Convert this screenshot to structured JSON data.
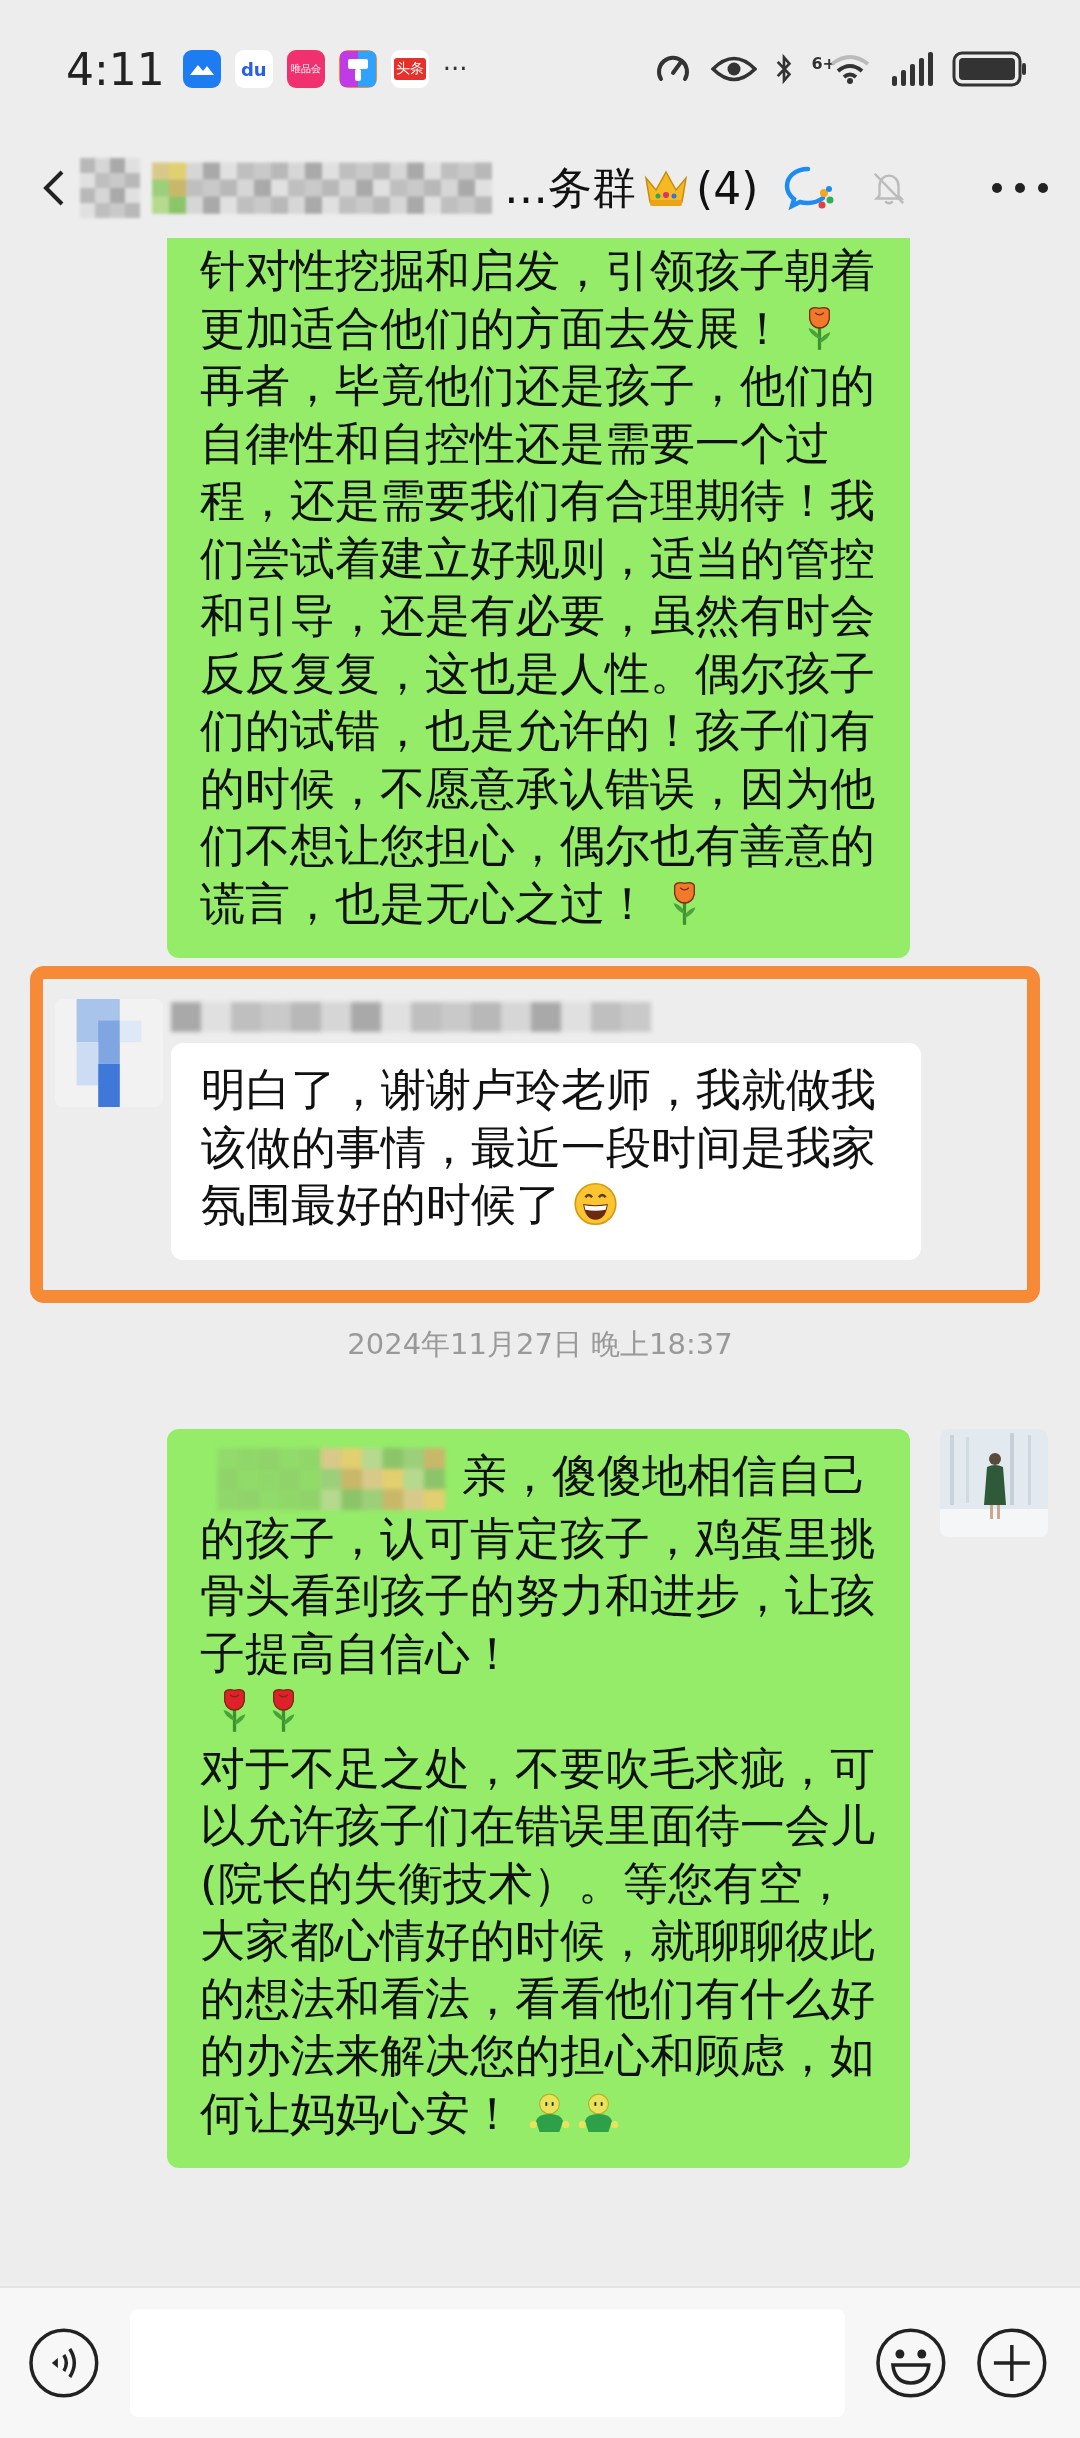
{
  "status_bar": {
    "time": "4:11",
    "notification_icons": [
      {
        "kind": "lark"
      },
      {
        "kind": "baidu",
        "text": "du"
      },
      {
        "kind": "vip",
        "text": "唯品会"
      },
      {
        "kind": "brush"
      },
      {
        "kind": "news",
        "text": "头条"
      }
    ],
    "more": "···",
    "wifi_label": "6+"
  },
  "header": {
    "title": "…务群",
    "member_count": "(4)"
  },
  "messages": [
    {
      "kind": "sent",
      "parts": [
        {
          "kind": "text",
          "text": "针对性挖掘和启发，引领孩子朝着"
        },
        {
          "kind": "text",
          "text": "更加适合他们的方面去发展！"
        },
        {
          "kind": "orange_rose"
        },
        {
          "kind": "text",
          "text": "再者，毕竟他们还是孩子，他们的自律性和自控性还是需要一个过程，还是需要我们有合理期待！我们尝试着建立好规则，适当的管控和引导，还是有必要，虽然有时会反反复复，这也是人性。偶尔孩子们的试错，也是允许的！孩子们有的时候，不愿意承认错误，因为他们不想让您担心，偶尔也有善意的"
        },
        {
          "kind": "text",
          "text": "谎言，也是无心之过！"
        },
        {
          "kind": "orange_rose"
        }
      ]
    },
    {
      "kind": "received",
      "highlighted": true,
      "parts": [
        {
          "kind": "text",
          "text": "明白了，谢谢卢玲老师，我就做我该做的事情，最近一段时间是我家"
        },
        {
          "kind": "text",
          "text": "氛围最好的时候了"
        },
        {
          "kind": "grin"
        }
      ]
    },
    {
      "kind": "time",
      "text": "2024年11月27日 晚上18:37"
    },
    {
      "kind": "sent",
      "parts": [
        {
          "kind": "redacted"
        },
        {
          "kind": "text",
          "text": "亲，傻傻地相信自己"
        },
        {
          "kind": "text",
          "text": "的孩子，认可肯定孩子，鸡蛋里挑骨头看到孩子的努力和进步，让孩子提高自信心！"
        },
        {
          "kind": "red_rose"
        },
        {
          "kind": "red_rose"
        },
        {
          "kind": "text",
          "text": "对于不足之处，不要吹毛求疵，可以允许孩子们在错误里面待一会儿(院长的失衡技术）。等您有空，大家都心情好的时候，就聊聊彼此的想法和看法，看看他们有什么好的办法来解决您的担心和顾虑，如"
        },
        {
          "kind": "text",
          "text": "何让妈妈心安！"
        },
        {
          "kind": "figure"
        },
        {
          "kind": "figure"
        }
      ]
    }
  ]
}
